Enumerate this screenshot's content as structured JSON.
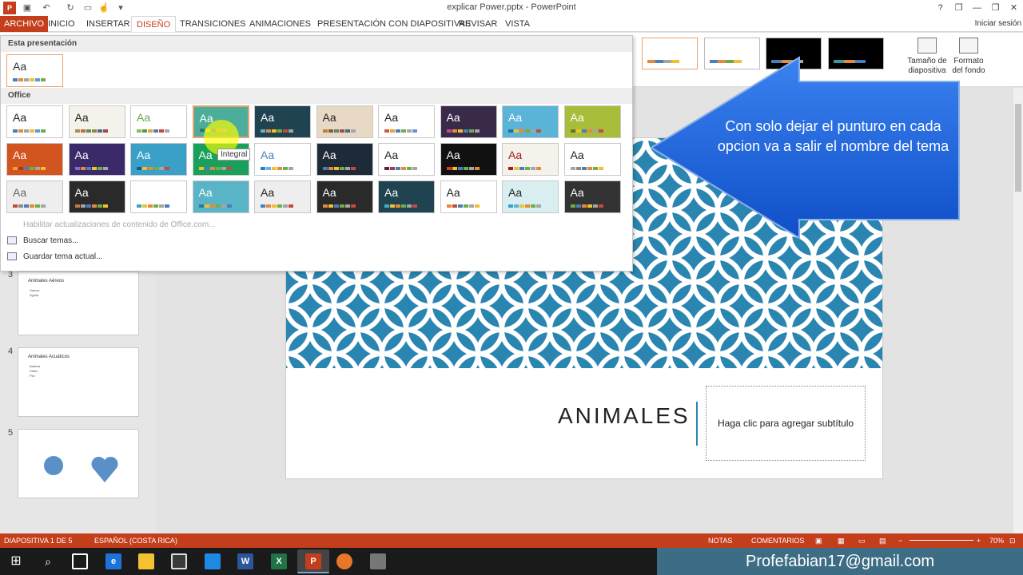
{
  "window": {
    "title": "explicar Power.pptx - PowerPoint",
    "sign_in": "Iniciar sesión",
    "buttons": [
      "?",
      "❐",
      "—",
      "❐",
      "✕"
    ]
  },
  "ribbon_tabs": [
    {
      "label": "ARCHIVO"
    },
    {
      "label": "INICIO"
    },
    {
      "label": "INSERTAR"
    },
    {
      "label": "DISEÑO"
    },
    {
      "label": "TRANSICIONES"
    },
    {
      "label": "ANIMACIONES"
    },
    {
      "label": "PRESENTACIÓN CON DIAPOSITIVAS"
    },
    {
      "label": "REVISAR"
    },
    {
      "label": "VISTA"
    }
  ],
  "ribbon": {
    "slide_size_label": "Tamaño de diapositiva",
    "format_bg_label": "Formato del fondo"
  },
  "themes_gallery": {
    "this_presentation_header": "Esta presentación",
    "office_header": "Office",
    "tooltip": "Integral",
    "aa_label": "Aa",
    "menu": {
      "enable_updates": "Habilitar actualizaciones de contenido de Office.com...",
      "search_themes": "Buscar temas...",
      "save_theme": "Guardar tema actual..."
    }
  },
  "slides_pane": [
    {
      "number": "3",
      "title": "Animales Aéreos",
      "bullets": [
        "Halcón",
        "Águila"
      ]
    },
    {
      "number": "4",
      "title": "Animales Acuáticos",
      "bullets": [
        "Ballena",
        "Delfín",
        "Pez"
      ]
    },
    {
      "number": "5"
    }
  ],
  "slide": {
    "title": "ANIMALES",
    "subtitle_placeholder": "Haga clic para agregar subtítulo"
  },
  "callout": {
    "text": "Con solo dejar el punturo en cada opcion va a salir el nombre del tema"
  },
  "status": {
    "slide_info": "DIAPOSITIVA 1 DE 5",
    "language": "ESPAÑOL (COSTA RICA)",
    "notes": "NOTAS",
    "comments": "COMENTARIOS",
    "zoom": "70%"
  },
  "watermark_email": "Profefabian17@gmail.com",
  "colors": {
    "accent": "#c43e1c",
    "slide_blue": "#2a86b0",
    "callout_blue": "#1a5fd6"
  }
}
